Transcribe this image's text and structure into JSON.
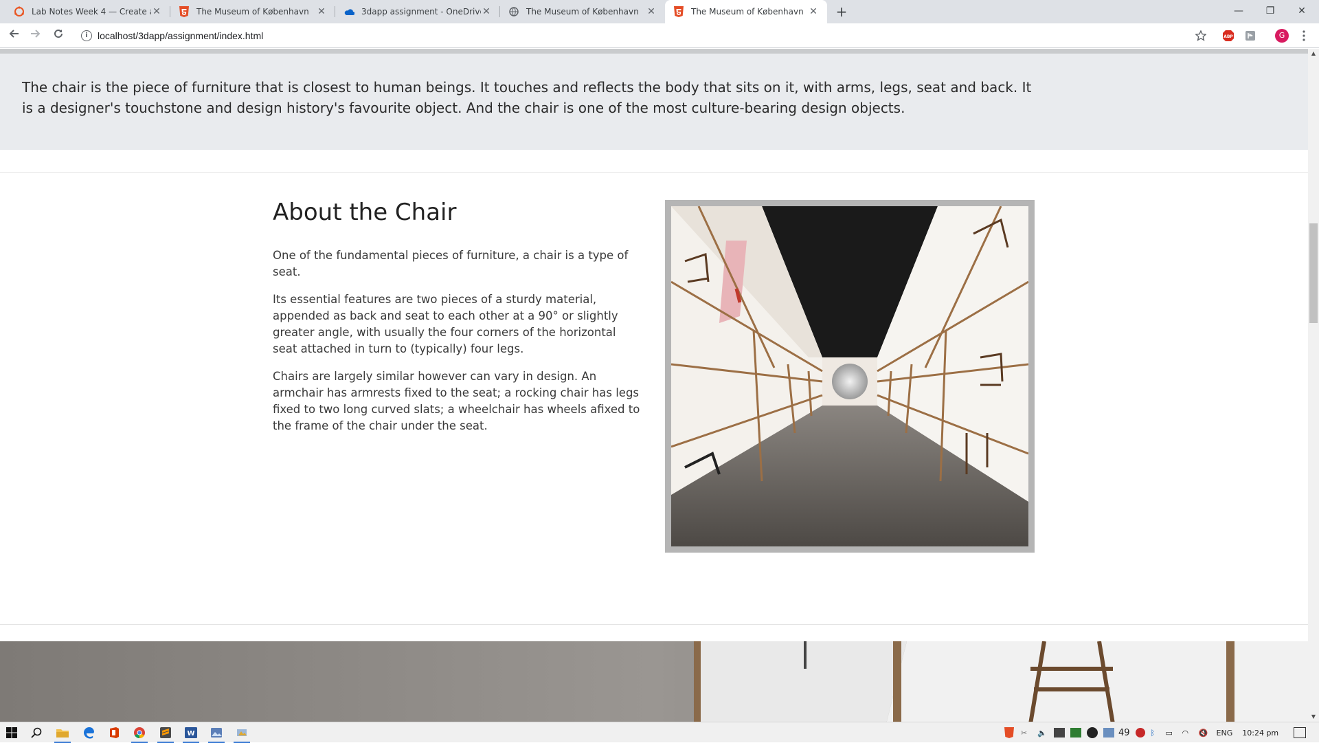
{
  "browser": {
    "tabs": [
      {
        "title": "Lab Notes Week 4 — Create a ba",
        "favicon": "ubuntu-icon",
        "active": false
      },
      {
        "title": "The Museum of København",
        "favicon": "html5-icon",
        "active": false
      },
      {
        "title": "3dapp assignment - OneDrive",
        "favicon": "onedrive-icon",
        "active": false
      },
      {
        "title": "The Museum of København",
        "favicon": "globe-icon",
        "active": false
      },
      {
        "title": "The Museum of København",
        "favicon": "html5-icon",
        "active": true
      }
    ],
    "url": "localhost/3dapp/assignment/index.html",
    "profile_initial": "G"
  },
  "page": {
    "intro_text": "The chair is the piece of furniture that is closest to human beings. It touches and reflects the body that sits on it, with arms, legs, seat and back. It is a designer's touchstone and design history's favourite object. And the chair is one of the most culture-bearing design objects.",
    "about": {
      "title": "About the Chair",
      "paragraphs": [
        "One of the fundamental pieces of furniture, a chair is a type of seat.",
        "Its essential features are two pieces of a sturdy material, appended as back and seat to each other at a 90° or slightly greater angle, with usually the four corners of the horizontal seat attached in turn to (typically) four legs.",
        "Chairs are largely similar however can vary in design. An armchair has armrests fixed to the seat; a rocking chair has legs fixed to two long curved slats; a wheelchair has wheels afixed to the frame of the chair under the seat."
      ]
    }
  },
  "taskbar": {
    "tray_count": "49",
    "language": "ENG",
    "time": "10:24 pm"
  },
  "colors": {
    "intro_bg": "#e9ebee",
    "frame": "#b5b5b5",
    "accent_blue": "#3a7bd5"
  }
}
